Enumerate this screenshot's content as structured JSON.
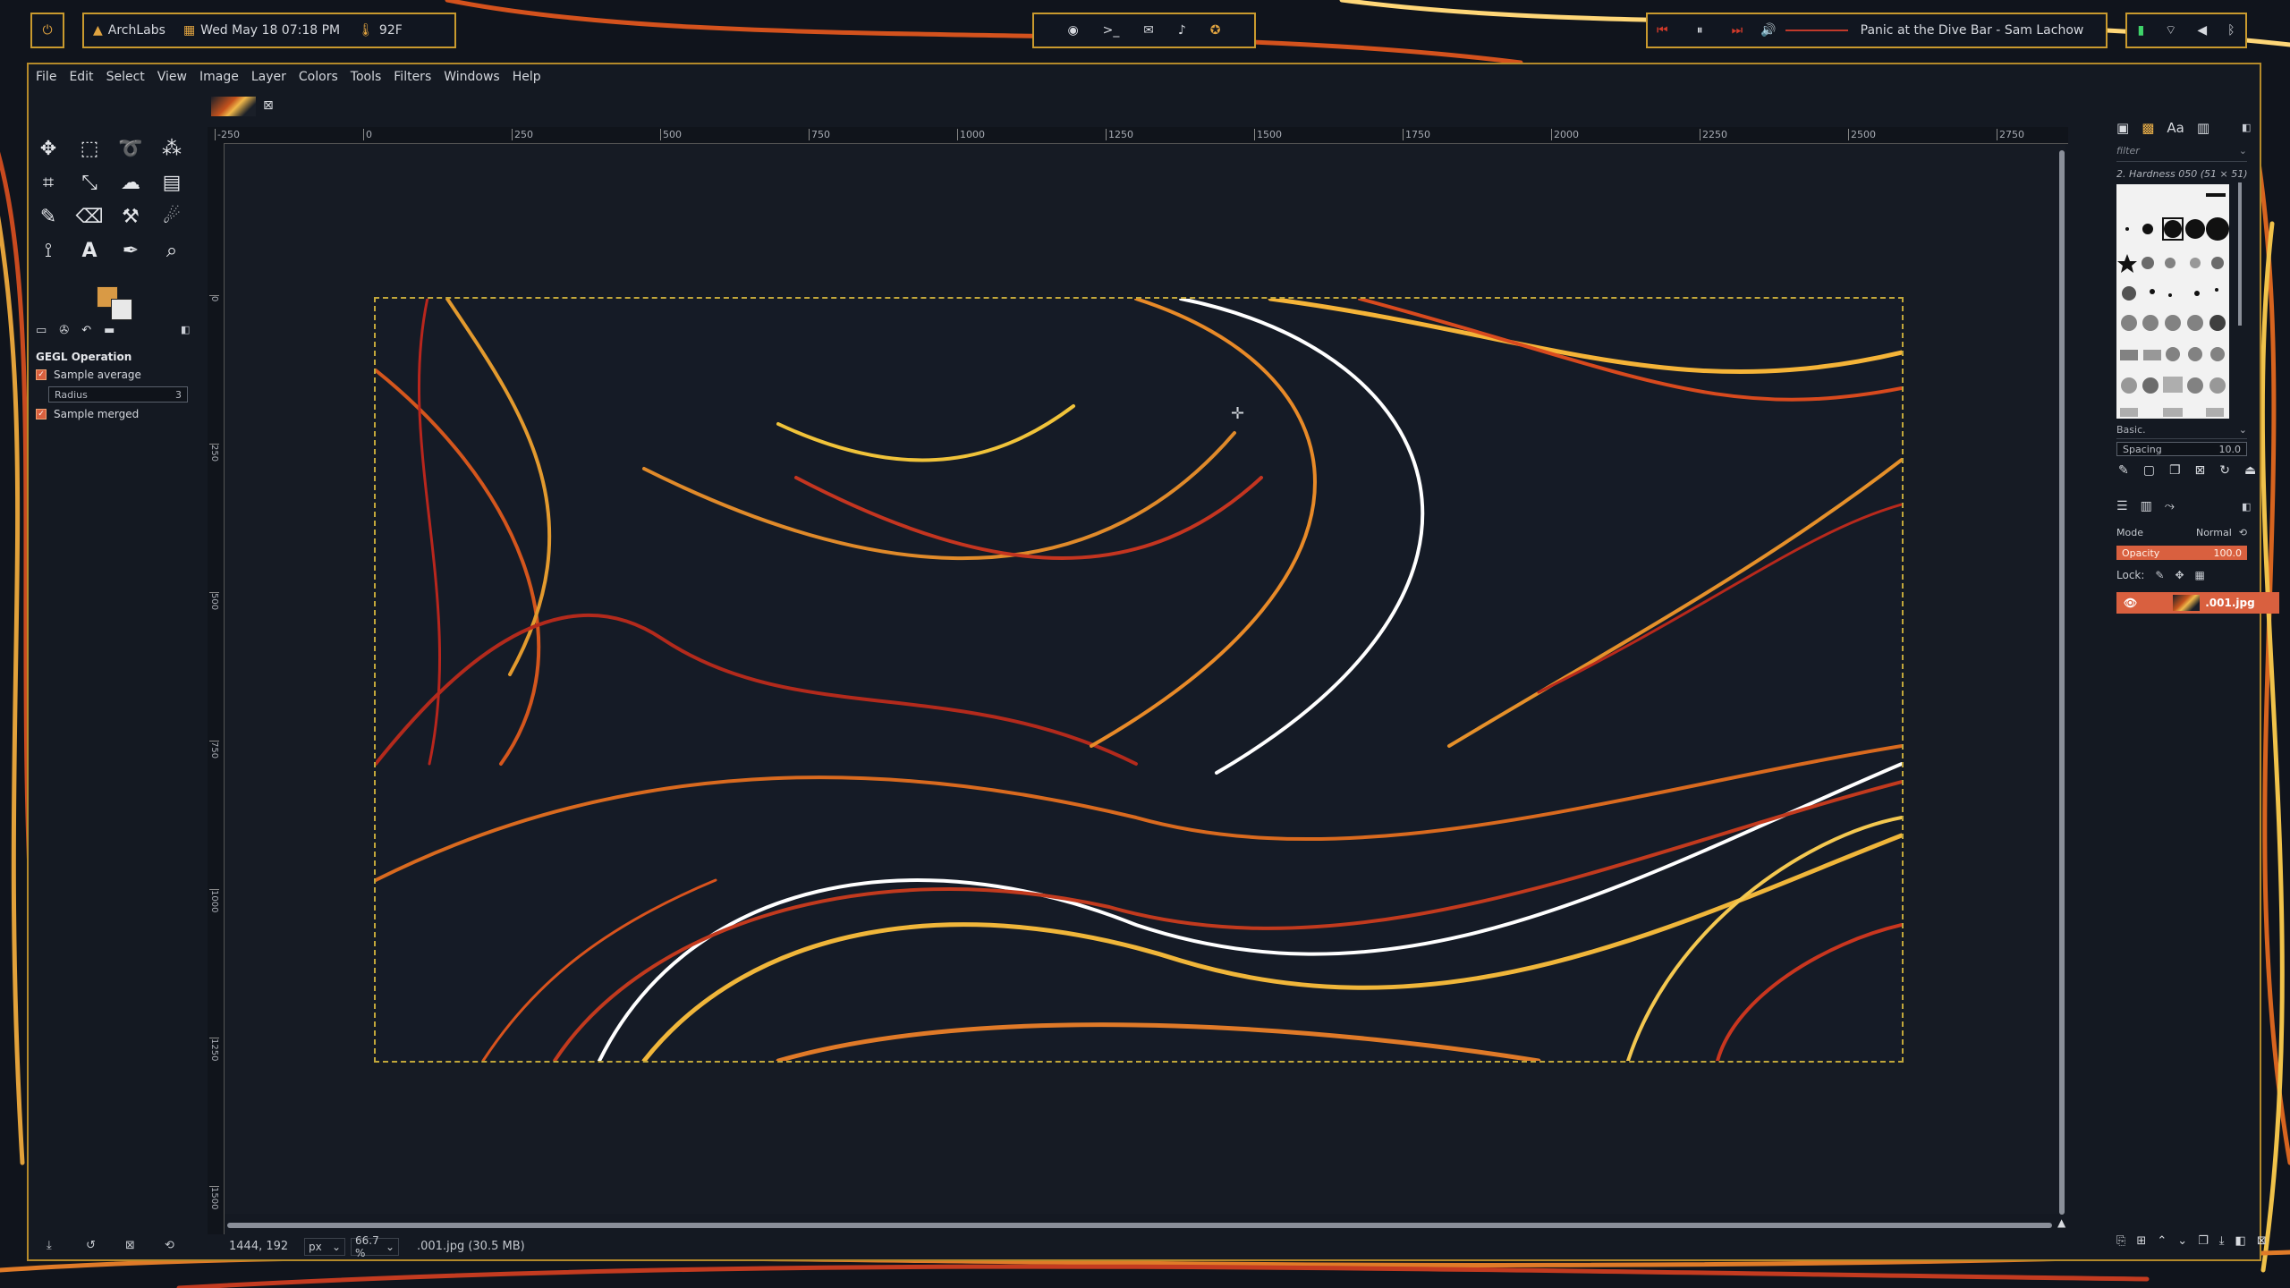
{
  "topbar": {
    "power_icon": "power-icon",
    "distro": "ArchLabs",
    "datetime": "Wed May 18 07:18 PM",
    "temperature": "92F",
    "launcher_icons": [
      "browser-icon",
      "terminal-icon",
      "mail-icon",
      "music-icon",
      "gimp-icon"
    ],
    "media_track": "Panic at the Dive Bar - Sam Lachow",
    "tray_icons": [
      "battery-icon",
      "wifi-icon",
      "volume-icon",
      "bluetooth-icon"
    ]
  },
  "menu": [
    "File",
    "Edit",
    "Select",
    "View",
    "Image",
    "Layer",
    "Colors",
    "Tools",
    "Filters",
    "Windows",
    "Help"
  ],
  "tool_options": {
    "title": "GEGL Operation",
    "sample_average": "Sample average",
    "radius_label": "Radius",
    "radius_value": "3",
    "sample_merged": "Sample merged"
  },
  "ruler": {
    "top_ticks": [
      "-250",
      "0",
      "250",
      "500",
      "750",
      "1000",
      "1250",
      "1500",
      "1750",
      "2000",
      "2250",
      "2500",
      "2750"
    ],
    "left_ticks": [
      "0",
      "250",
      "500",
      "750",
      "1000",
      "1250",
      "1500"
    ]
  },
  "status": {
    "coords": "1444, 192",
    "unit": "px",
    "zoom": "66.7 %",
    "file_info": ".001.jpg (30.5 MB)"
  },
  "dock": {
    "filter_placeholder": "filter",
    "brush_name": "2. Hardness 050 (51 × 51)",
    "brush_set": "Basic.",
    "spacing_label": "Spacing",
    "spacing_value": "10.0",
    "mode_label": "Mode",
    "mode_value": "Normal",
    "opacity_label": "Opacity",
    "opacity_value": "100.0",
    "lock_label": "Lock:",
    "layer_name": ".001.jpg"
  },
  "colors": {
    "accent": "#c99a2e",
    "foreground": "#d99a45",
    "background": "#e8e8e8",
    "selection": "#d9603f"
  }
}
